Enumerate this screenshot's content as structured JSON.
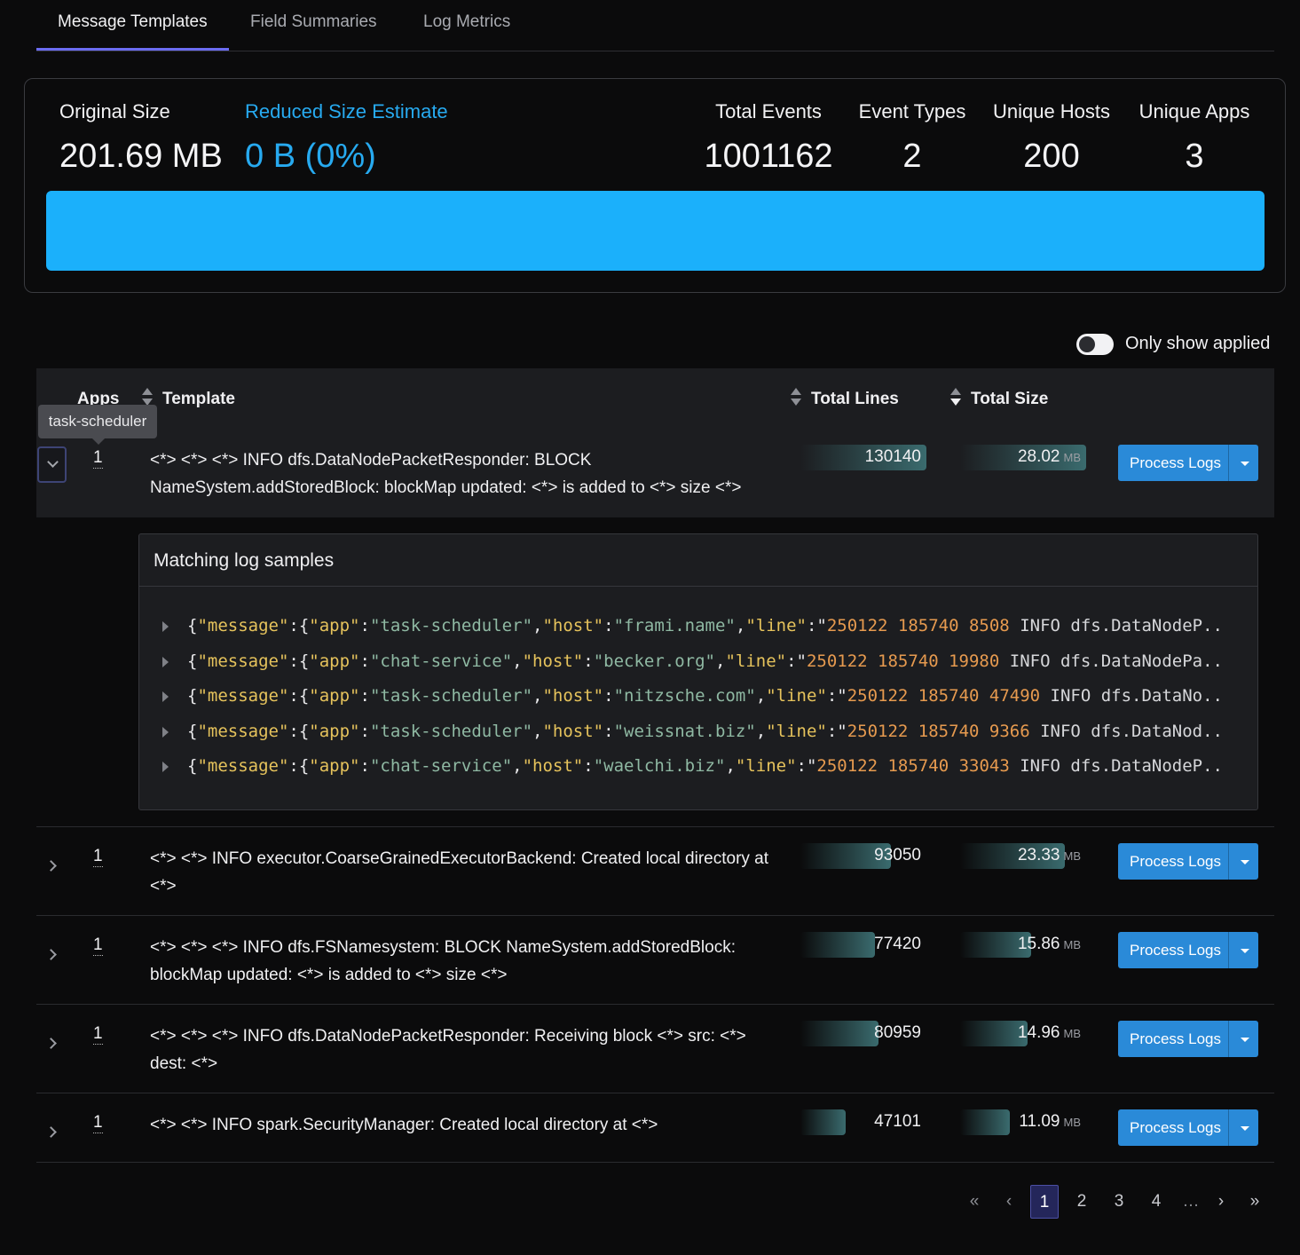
{
  "tabs": [
    "Message Templates",
    "Field Summaries",
    "Log Metrics"
  ],
  "summary": {
    "original_size_label": "Original Size",
    "original_size_value": "201.69 MB",
    "reduced_label": "Reduced Size Estimate",
    "reduced_value": "0 B (0%)",
    "total_events_label": "Total Events",
    "total_events_value": "1001162",
    "event_types_label": "Event Types",
    "event_types_value": "2",
    "unique_hosts_label": "Unique Hosts",
    "unique_hosts_value": "200",
    "unique_apps_label": "Unique Apps",
    "unique_apps_value": "3",
    "bar_color": "#1bb0fb"
  },
  "toggle": {
    "label": "Only show applied",
    "on": false
  },
  "table": {
    "headers": {
      "apps": "Apps",
      "template": "Template",
      "total_lines": "Total Lines",
      "total_size": "Total Size"
    },
    "tooltip": "task-scheduler",
    "action_label": "Process Logs",
    "rows": [
      {
        "apps": "1",
        "template": "<*> <*> <*> INFO dfs.DataNodePacketResponder: BLOCK NameSystem.addStoredBlock: blockMap updated: <*> is added to <*> size <*>",
        "lines": "130140",
        "size": "28.02",
        "unit": "MB",
        "lines_fraction": 1.0,
        "size_fraction": 1.0,
        "expanded": true
      },
      {
        "apps": "1",
        "template": "<*> <*> INFO executor.CoarseGrainedExecutorBackend: Created local directory at <*>",
        "lines": "93050",
        "size": "23.33",
        "unit": "MB",
        "lines_fraction": 0.715,
        "size_fraction": 0.833,
        "expanded": false
      },
      {
        "apps": "1",
        "template": "<*> <*> <*> INFO dfs.FSNamesystem: BLOCK NameSystem.addStoredBlock: blockMap updated: <*> is added to <*> size <*>",
        "lines": "77420",
        "size": "15.86",
        "unit": "MB",
        "lines_fraction": 0.595,
        "size_fraction": 0.566,
        "expanded": false
      },
      {
        "apps": "1",
        "template": "<*> <*> <*> INFO dfs.DataNodePacketResponder: Receiving block <*> src: <*> dest: <*>",
        "lines": "80959",
        "size": "14.96",
        "unit": "MB",
        "lines_fraction": 0.622,
        "size_fraction": 0.534,
        "expanded": false
      },
      {
        "apps": "1",
        "template": "<*> <*> INFO spark.SecurityManager: Created local directory at <*>",
        "lines": "47101",
        "size": "11.09",
        "unit": "MB",
        "lines_fraction": 0.362,
        "size_fraction": 0.396,
        "expanded": false
      }
    ]
  },
  "samples": {
    "title": "Matching log samples",
    "lines": [
      {
        "app": "task-scheduler",
        "host": "frami.name",
        "line_num": "250122 185740 8508",
        "rest": "INFO dfs.DataNodeP..."
      },
      {
        "app": "chat-service",
        "host": "becker.org",
        "line_num": "250122 185740 19980",
        "rest": "INFO dfs.DataNodePa..."
      },
      {
        "app": "task-scheduler",
        "host": "nitzsche.com",
        "line_num": "250122 185740 47490",
        "rest": "INFO dfs.DataNo..."
      },
      {
        "app": "task-scheduler",
        "host": "weissnat.biz",
        "line_num": "250122 185740 9366",
        "rest": "INFO dfs.DataNod..."
      },
      {
        "app": "chat-service",
        "host": "waelchi.biz",
        "line_num": "250122 185740 33043",
        "rest": "INFO dfs.DataNodeP..."
      }
    ]
  },
  "pagination": {
    "first": "«",
    "prev": "‹",
    "pages": [
      "1",
      "2",
      "3",
      "4"
    ],
    "ellipsis": "…",
    "next": "›",
    "last": "»",
    "current": "1"
  }
}
